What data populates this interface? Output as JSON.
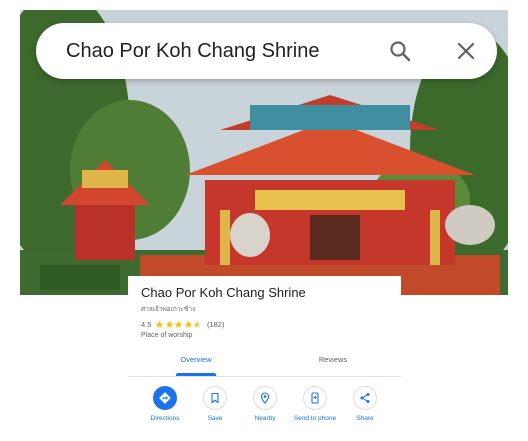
{
  "search": {
    "query": "Chao Por Koh Chang Shrine"
  },
  "place": {
    "name": "Chao Por Koh Chang Shrine",
    "local_name": "ศาลเจ้าพ่อเกาะช้าง",
    "rating": "4.5",
    "rating_stars": 4.5,
    "review_count": "(182)",
    "category": "Place of worship"
  },
  "tabs": [
    {
      "label": "Overview",
      "active": true
    },
    {
      "label": "Reviews",
      "active": false
    }
  ],
  "actions": [
    {
      "label": "Directions",
      "icon": "directions-icon"
    },
    {
      "label": "Save",
      "icon": "bookmark-icon"
    },
    {
      "label": "Nearby",
      "icon": "nearby-icon"
    },
    {
      "label": "Send to phone",
      "icon": "send-to-phone-icon"
    },
    {
      "label": "Share",
      "icon": "share-icon"
    }
  ],
  "colors": {
    "accent": "#1a73e8",
    "star": "#fbbc04",
    "text_primary": "#202124",
    "text_secondary": "#5f6368"
  }
}
